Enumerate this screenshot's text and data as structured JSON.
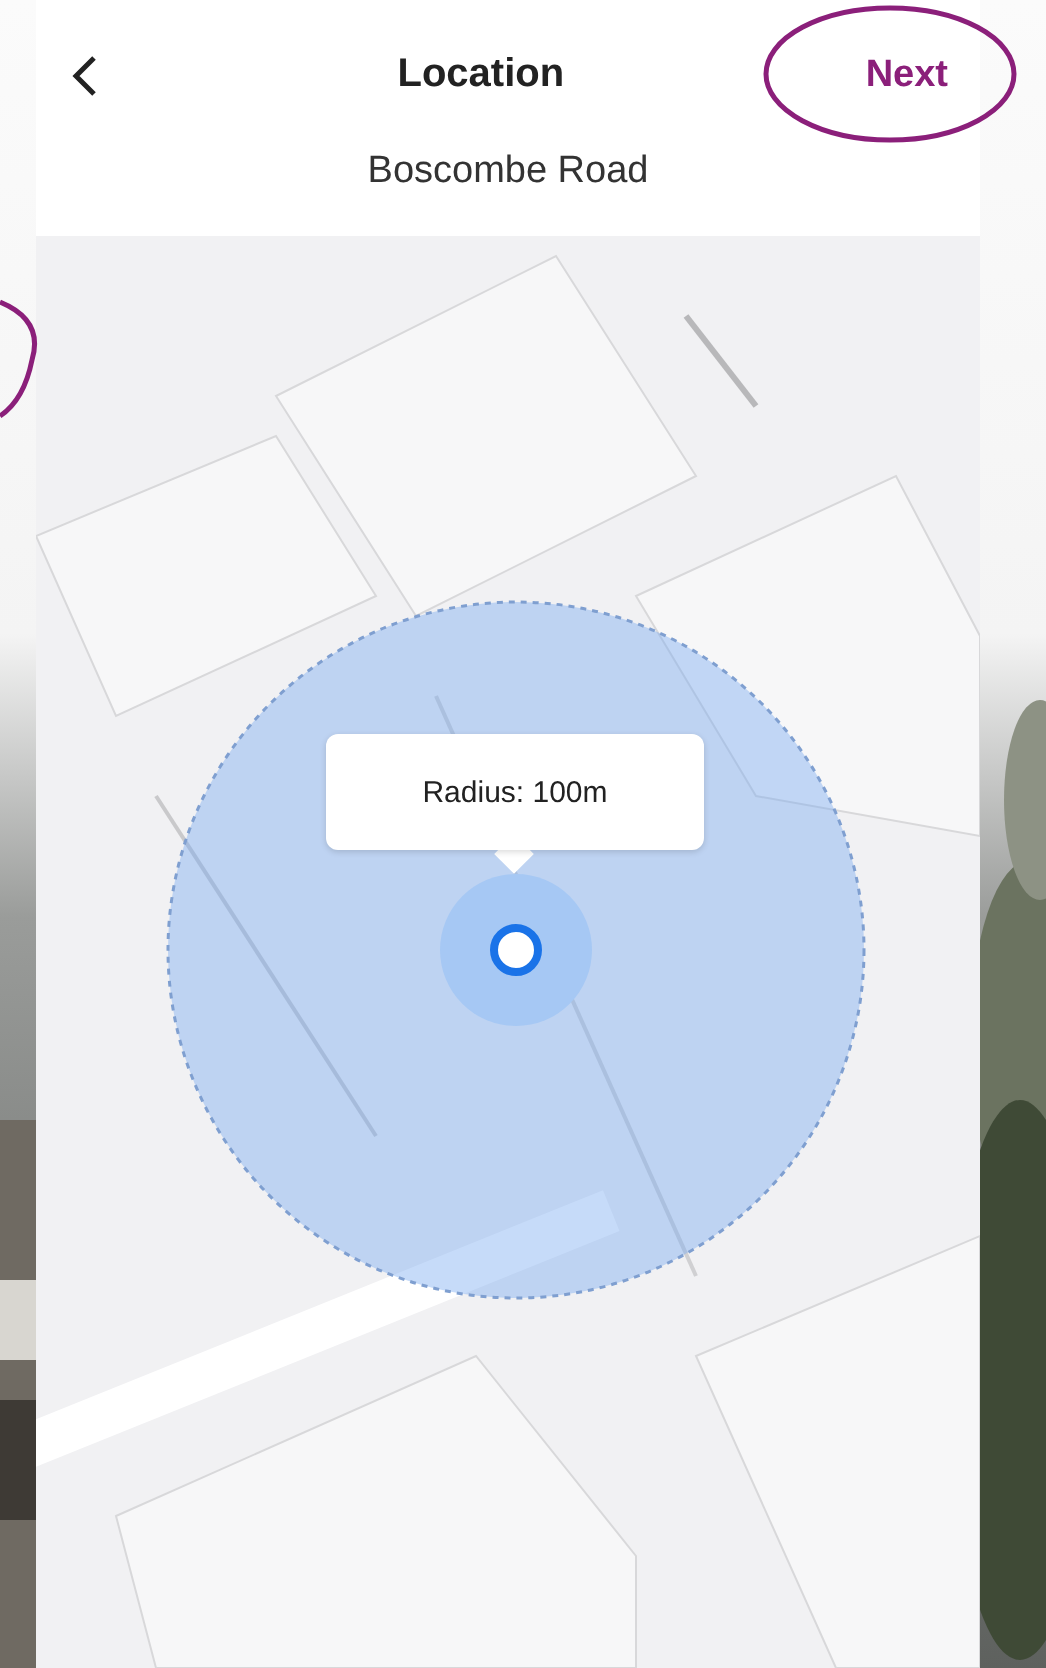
{
  "header": {
    "title": "Location",
    "next": "Next"
  },
  "subtitle": "Boscombe Road",
  "map": {
    "radius_label": "Radius: 100m"
  }
}
